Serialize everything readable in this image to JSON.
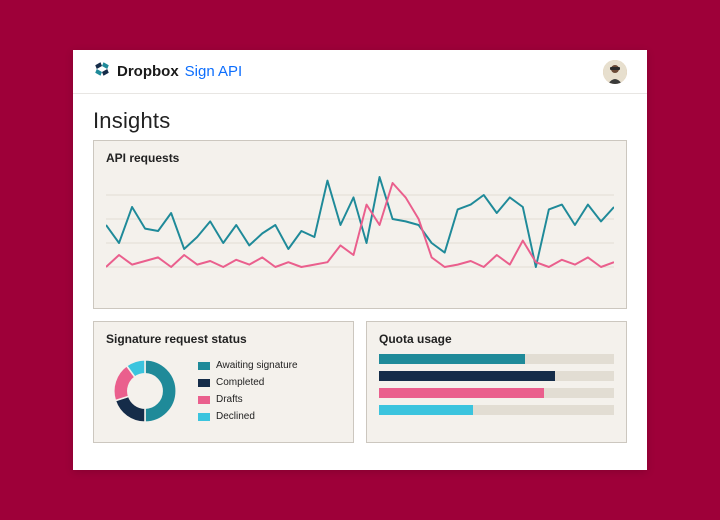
{
  "header": {
    "brand_name": "Dropbox",
    "brand_sub": "Sign API"
  },
  "page_title": "Insights",
  "panels": {
    "api_requests_title": "API requests",
    "sig_status_title": "Signature request status",
    "quota_title": "Quota usage"
  },
  "colors": {
    "teal": "#1f8a99",
    "navy": "#152c49",
    "pink": "#ea5f8d",
    "cyan": "#3bc4de",
    "track": "#e2ddd3"
  },
  "legend": {
    "awaiting": "Awaiting signature",
    "completed": "Completed",
    "drafts": "Drafts",
    "declined": "Declined"
  },
  "chart_data": [
    {
      "type": "line",
      "title": "API requests",
      "x": [
        0,
        1,
        2,
        3,
        4,
        5,
        6,
        7,
        8,
        9,
        10,
        11,
        12,
        13,
        14,
        15,
        16,
        17,
        18,
        19,
        20,
        21,
        22,
        23,
        24,
        25,
        26,
        27,
        28,
        29,
        30,
        31,
        32,
        33,
        34,
        35,
        36,
        37,
        38,
        39
      ],
      "ylim": [
        0,
        100
      ],
      "series": [
        {
          "name": "series_teal",
          "color": "#1f8a99",
          "values": [
            55,
            40,
            70,
            52,
            50,
            65,
            35,
            45,
            58,
            40,
            55,
            38,
            48,
            55,
            35,
            50,
            45,
            92,
            55,
            78,
            40,
            95,
            60,
            58,
            55,
            40,
            32,
            68,
            72,
            80,
            65,
            78,
            70,
            20,
            68,
            72,
            55,
            72,
            58,
            70
          ]
        },
        {
          "name": "series_pink",
          "color": "#ea5f8d",
          "values": [
            20,
            30,
            22,
            25,
            28,
            20,
            30,
            22,
            25,
            20,
            26,
            22,
            28,
            20,
            24,
            20,
            22,
            24,
            38,
            30,
            72,
            55,
            90,
            78,
            60,
            28,
            20,
            22,
            25,
            20,
            30,
            22,
            42,
            24,
            20,
            26,
            22,
            28,
            20,
            24
          ]
        }
      ]
    },
    {
      "type": "pie",
      "title": "Signature request status",
      "series": [
        {
          "name": "Awaiting signature",
          "value": 50,
          "color": "#1f8a99"
        },
        {
          "name": "Completed",
          "value": 20,
          "color": "#152c49"
        },
        {
          "name": "Drafts",
          "value": 20,
          "color": "#ea5f8d"
        },
        {
          "name": "Declined",
          "value": 10,
          "color": "#3bc4de"
        }
      ]
    },
    {
      "type": "bar",
      "title": "Quota usage",
      "ylim": [
        0,
        100
      ],
      "series": [
        {
          "name": "bar1",
          "value": 62,
          "color": "#1f8a99"
        },
        {
          "name": "bar2",
          "value": 75,
          "color": "#152c49"
        },
        {
          "name": "bar3",
          "value": 70,
          "color": "#ea5f8d"
        },
        {
          "name": "bar4",
          "value": 40,
          "color": "#3bc4de"
        }
      ]
    }
  ]
}
